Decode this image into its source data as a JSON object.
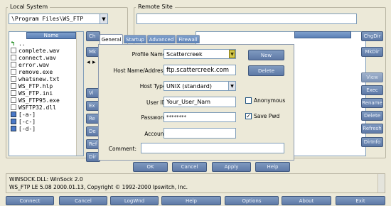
{
  "local": {
    "title": "Local System",
    "path": "\\Program Files\\WS_FTP",
    "column_header": "Name",
    "files": [
      {
        "icon": "up",
        "name": ".."
      },
      {
        "icon": "file",
        "name": "complete.wav"
      },
      {
        "icon": "file",
        "name": "connect.wav"
      },
      {
        "icon": "file",
        "name": "error.wav"
      },
      {
        "icon": "file",
        "name": "remove.exe"
      },
      {
        "icon": "file",
        "name": "whatsnew.txt"
      },
      {
        "icon": "file",
        "name": "WS_FTP.hlp"
      },
      {
        "icon": "file",
        "name": "WS_FTP.ini"
      },
      {
        "icon": "file",
        "name": "WS_FTP95.exe"
      },
      {
        "icon": "file",
        "name": "WSFTP32.dll"
      },
      {
        "icon": "drive",
        "name": "[-a-]"
      },
      {
        "icon": "drive",
        "name": "[-c-]"
      },
      {
        "icon": "drive",
        "name": "[-d-]"
      }
    ],
    "side_buttons": [
      "Ch",
      "Mk",
      "",
      "",
      "Vi",
      "Ex",
      "Re",
      "De",
      "Ref",
      "Dir"
    ]
  },
  "remote": {
    "title": "Remote Site",
    "side_buttons": [
      "ChgDir",
      "MkDir",
      "",
      "View",
      "Exec",
      "Rename",
      "Delete",
      "Refresh",
      "DirInfo"
    ]
  },
  "dialog": {
    "tabs": [
      "General",
      "Startup",
      "Advanced",
      "Firewall"
    ],
    "active_tab": "General",
    "labels": {
      "profile_name": "Profile Name:",
      "host_name": "Host Name/Address:",
      "host_type": "Host Type:",
      "user_id": "User ID:",
      "password": "Password:",
      "account": "Account:",
      "comment": "Comment:",
      "anonymous": "Anonymous",
      "save_pwd": "Save Pwd"
    },
    "values": {
      "profile_name": "Scattercreek",
      "host_name": "ftp.scattercreek.com",
      "host_type": "UNIX (standard)",
      "user_id": "Your_User_Nam",
      "password": "********",
      "account": "",
      "comment": ""
    },
    "checks": {
      "anonymous": false,
      "save_pwd": true
    },
    "buttons": {
      "new": "New",
      "delete": "Delete",
      "ok": "OK",
      "cancel": "Cancel",
      "apply": "Apply",
      "help": "Help"
    }
  },
  "log": {
    "line1": "WINSOCK.DLL: WinSock 2.0",
    "line2": "WS_FTP LE 5.08 2000.01.13, Copyright © 1992-2000 Ipswitch, Inc."
  },
  "bottom_bar": [
    "Connect",
    "Cancel",
    "LogWnd",
    "Help",
    "Options",
    "About",
    "Exit"
  ],
  "colors": {
    "window": "#ece9d8",
    "button": "#6b86b3",
    "tab_active": "#ffffff",
    "tab_inactive": "#6a8fc4",
    "selector": "#d4c84a"
  }
}
